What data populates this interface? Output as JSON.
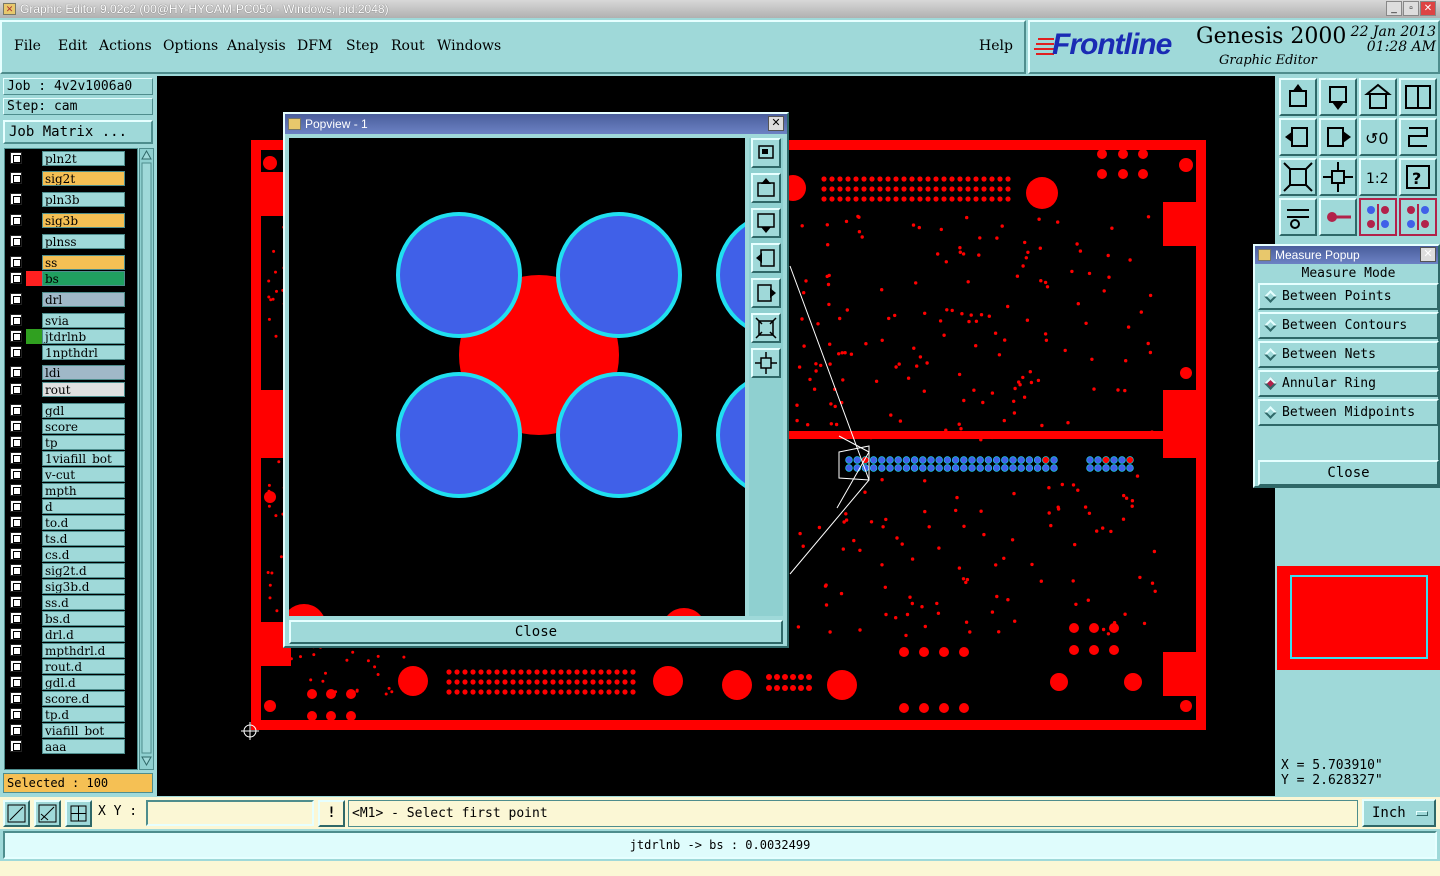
{
  "window": {
    "title": "Graphic Editor 9.02c2 (00@HY-HYCAM-PC050 - Windows, pid:2048)",
    "min": "_",
    "max": "▫",
    "close": "✕"
  },
  "menu": [
    "File",
    "Edit",
    "Actions",
    "Options",
    "Analysis",
    "DFM",
    "Step",
    "Rout",
    "Windows"
  ],
  "help": "Help",
  "brand": {
    "logo": "Frontline",
    "product": "Genesis 2000",
    "subtitle": "Graphic Editor",
    "date": "22 Jan 2013",
    "time": "01:28 AM"
  },
  "job": {
    "job_line": "Job : 4v2v1006a0",
    "step_line": "Step: cam",
    "matrix_button": "Job Matrix ..."
  },
  "layers": [
    {
      "name": "pln2t",
      "bg": "#9fd9d9",
      "color": "#000000"
    },
    {
      "name": "sig2t",
      "bg": "#f5c054",
      "color": "#000000"
    },
    {
      "name": "pln3b",
      "bg": "#9fd9d9",
      "color": "#000000"
    },
    {
      "name": "sig3b",
      "bg": "#f5c054",
      "color": "#000000"
    },
    {
      "name": "plnss",
      "bg": "#9fd9d9",
      "color": "#000000"
    },
    {
      "name": "ss",
      "bg": "#f5c054",
      "color": "#000000"
    },
    {
      "name": "bs",
      "bg": "#20a060",
      "color": "#ff2020"
    },
    {
      "name": "drl",
      "bg": "#a0b8c8",
      "color": "#000000"
    },
    {
      "name": "svia",
      "bg": "#9fd9d9",
      "color": "#000000"
    },
    {
      "name": "jtdrlnb",
      "bg": "#9fd9d9",
      "color": "#30a020"
    },
    {
      "name": "1npthdrl",
      "bg": "#9fd9d9",
      "color": "#000000"
    },
    {
      "name": "ldi",
      "bg": "#a0b8c8",
      "color": "#000000"
    },
    {
      "name": "rout",
      "bg": "#e0e0e0",
      "color": "#000000"
    },
    {
      "name": "gdl",
      "bg": "#9fd9d9",
      "color": "#000000"
    },
    {
      "name": "score",
      "bg": "#9fd9d9",
      "color": "#000000"
    },
    {
      "name": "tp",
      "bg": "#9fd9d9",
      "color": "#000000"
    },
    {
      "name": "1viafill_bot",
      "bg": "#9fd9d9",
      "color": "#000000"
    },
    {
      "name": "v-cut",
      "bg": "#9fd9d9",
      "color": "#000000"
    },
    {
      "name": "mpth",
      "bg": "#9fd9d9",
      "color": "#000000"
    },
    {
      "name": "d",
      "bg": "#9fd9d9",
      "color": "#000000"
    },
    {
      "name": "to.d",
      "bg": "#9fd9d9",
      "color": "#000000"
    },
    {
      "name": "ts.d",
      "bg": "#9fd9d9",
      "color": "#000000"
    },
    {
      "name": "cs.d",
      "bg": "#9fd9d9",
      "color": "#000000"
    },
    {
      "name": "sig2t.d",
      "bg": "#9fd9d9",
      "color": "#000000"
    },
    {
      "name": "sig3b.d",
      "bg": "#9fd9d9",
      "color": "#000000"
    },
    {
      "name": "ss.d",
      "bg": "#9fd9d9",
      "color": "#000000"
    },
    {
      "name": "bs.d",
      "bg": "#9fd9d9",
      "color": "#000000"
    },
    {
      "name": "drl.d",
      "bg": "#9fd9d9",
      "color": "#000000"
    },
    {
      "name": "mpthdrl.d",
      "bg": "#9fd9d9",
      "color": "#000000"
    },
    {
      "name": "rout.d",
      "bg": "#9fd9d9",
      "color": "#000000"
    },
    {
      "name": "gdl.d",
      "bg": "#9fd9d9",
      "color": "#000000"
    },
    {
      "name": "score.d",
      "bg": "#9fd9d9",
      "color": "#000000"
    },
    {
      "name": "tp.d",
      "bg": "#9fd9d9",
      "color": "#000000"
    },
    {
      "name": "viafill_bot",
      "bg": "#9fd9d9",
      "color": "#000000"
    },
    {
      "name": "aaa",
      "bg": "#9fd9d9",
      "color": "#000000"
    }
  ],
  "selected": "Selected : 100",
  "popview": {
    "title": "Popview - 1",
    "close_label": "Close"
  },
  "measure": {
    "title": "Measure Popup",
    "mode_heading": "Measure Mode",
    "options": [
      "Between Points",
      "Between Contours",
      "Between Nets",
      "Annular Ring",
      "Between Midpoints"
    ],
    "selected_option": "Annular Ring",
    "close_label": "Close"
  },
  "coords": {
    "x": "X = 5.703910\"",
    "y": "Y = 2.628327\""
  },
  "bottom": {
    "xy_label": "X Y :",
    "xy_value": "",
    "bang": "!",
    "prompt": "<M1> - Select first point",
    "units": "Inch"
  },
  "status": "jtdrlnb -> bs : 0.0032499",
  "colors": {
    "panel": "#9fd9d9",
    "pad": "#ff0000",
    "via_blue": "#4060e8",
    "ring_cyan": "#20e0f0",
    "canvas": "#000000",
    "layer_yellow": "#f5c054"
  }
}
